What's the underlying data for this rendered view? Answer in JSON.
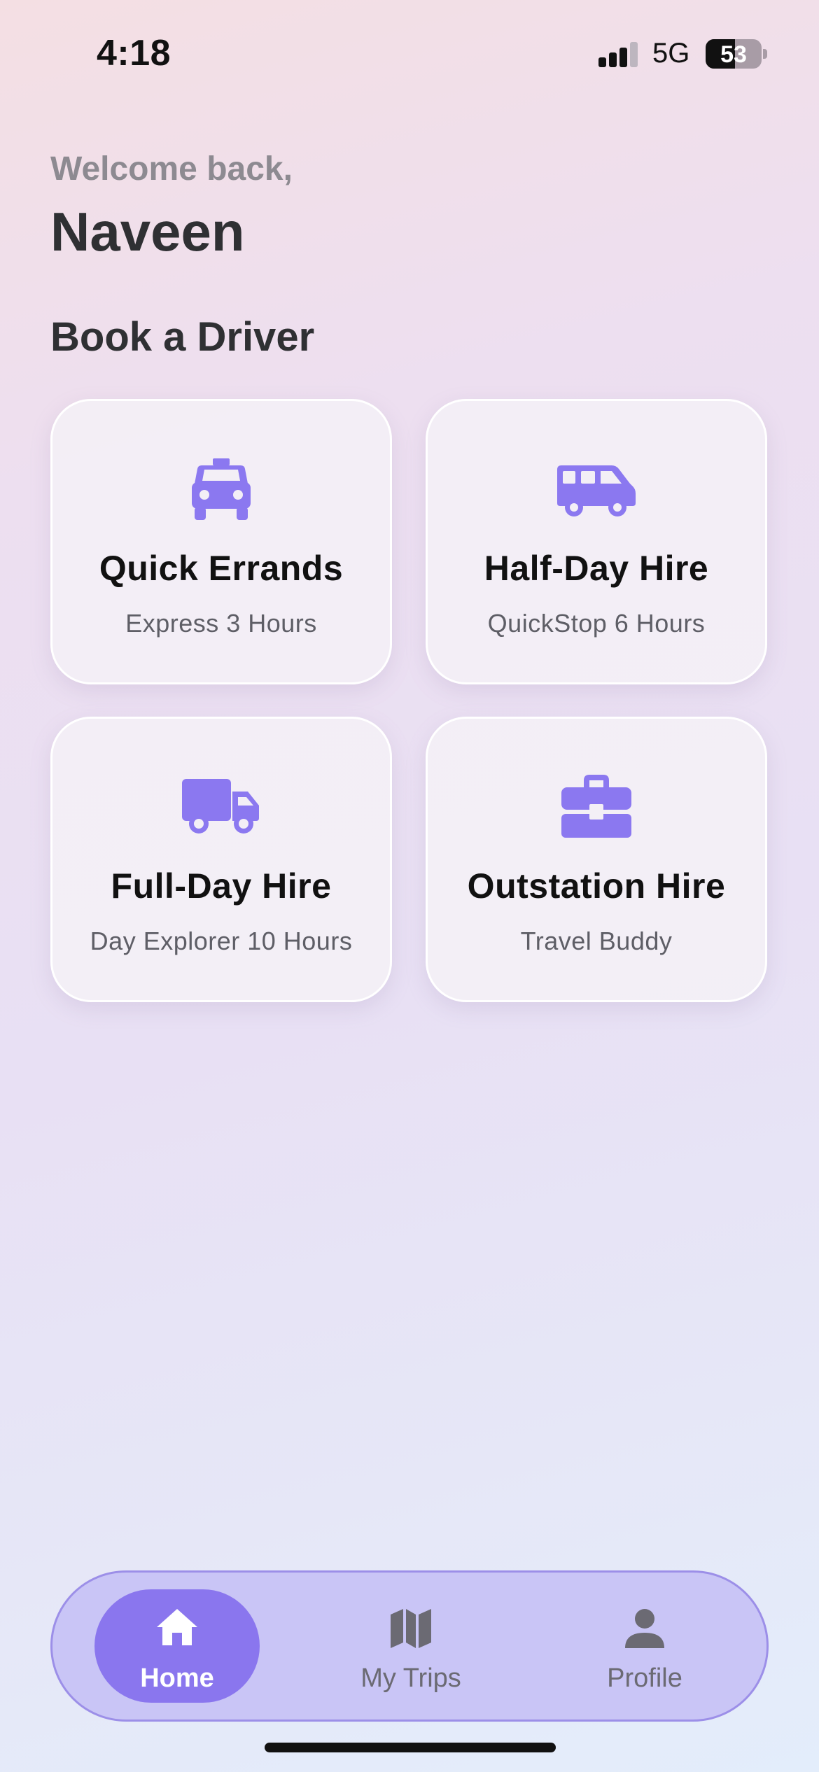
{
  "status_bar": {
    "time": "4:18",
    "network": "5G",
    "battery": "53"
  },
  "header": {
    "welcome": "Welcome back,",
    "name": "Naveen"
  },
  "section_title": "Book a Driver",
  "services": [
    {
      "title": "Quick Errands",
      "subtitle": "Express 3 Hours",
      "icon": "taxi-icon"
    },
    {
      "title": "Half-Day Hire",
      "subtitle": "QuickStop 6 Hours",
      "icon": "van-icon"
    },
    {
      "title": "Full-Day Hire",
      "subtitle": "Day Explorer 10 Hours",
      "icon": "truck-icon"
    },
    {
      "title": "Outstation Hire",
      "subtitle": "Travel Buddy",
      "icon": "briefcase-icon"
    }
  ],
  "bottom_nav": [
    {
      "label": "Home",
      "icon": "home-icon",
      "active": true
    },
    {
      "label": "My Trips",
      "icon": "map-icon",
      "active": false
    },
    {
      "label": "Profile",
      "icon": "person-icon",
      "active": false
    }
  ],
  "colors": {
    "accent": "#8a76ee",
    "icon_purple": "#8b78f0",
    "nav_background": "#c9c5f6",
    "text_dark": "#2f3033"
  }
}
